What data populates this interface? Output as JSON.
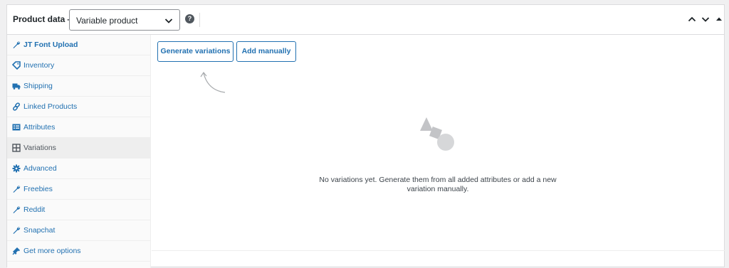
{
  "header": {
    "label": "Product data —",
    "product_type": {
      "selected": "Variable product",
      "chevron_icon": "chevron-down-icon"
    },
    "help_icon": "help-icon",
    "controls": [
      "move-up-icon",
      "move-down-icon",
      "collapse-toggle-icon"
    ]
  },
  "sidebar": {
    "tabs": [
      {
        "label": "JT Font Upload",
        "icon": "wrench-icon",
        "bold": true
      },
      {
        "label": "Inventory",
        "icon": "tag-icon"
      },
      {
        "label": "Shipping",
        "icon": "truck-icon"
      },
      {
        "label": "Linked Products",
        "icon": "link-icon"
      },
      {
        "label": "Attributes",
        "icon": "list-icon"
      },
      {
        "label": "Variations",
        "icon": "grid-icon",
        "active": true
      },
      {
        "label": "Advanced",
        "icon": "gear-icon"
      },
      {
        "label": "Freebies",
        "icon": "wrench-icon"
      },
      {
        "label": "Reddit",
        "icon": "wrench-icon"
      },
      {
        "label": "Snapchat",
        "icon": "wrench-icon"
      },
      {
        "label": "Get more options",
        "icon": "plugin-icon"
      }
    ]
  },
  "main": {
    "generate_button": "Generate variations",
    "add_manually_button": "Add manually",
    "empty_icon": "shapes-icon",
    "empty_message": "No variations yet. Generate them from all added attributes or add a new variation manually."
  },
  "colors": {
    "link": "#2271b1",
    "border": "#dcdcde",
    "active_tab_bg": "#eeeeee",
    "muted": "#c3c4c7"
  }
}
